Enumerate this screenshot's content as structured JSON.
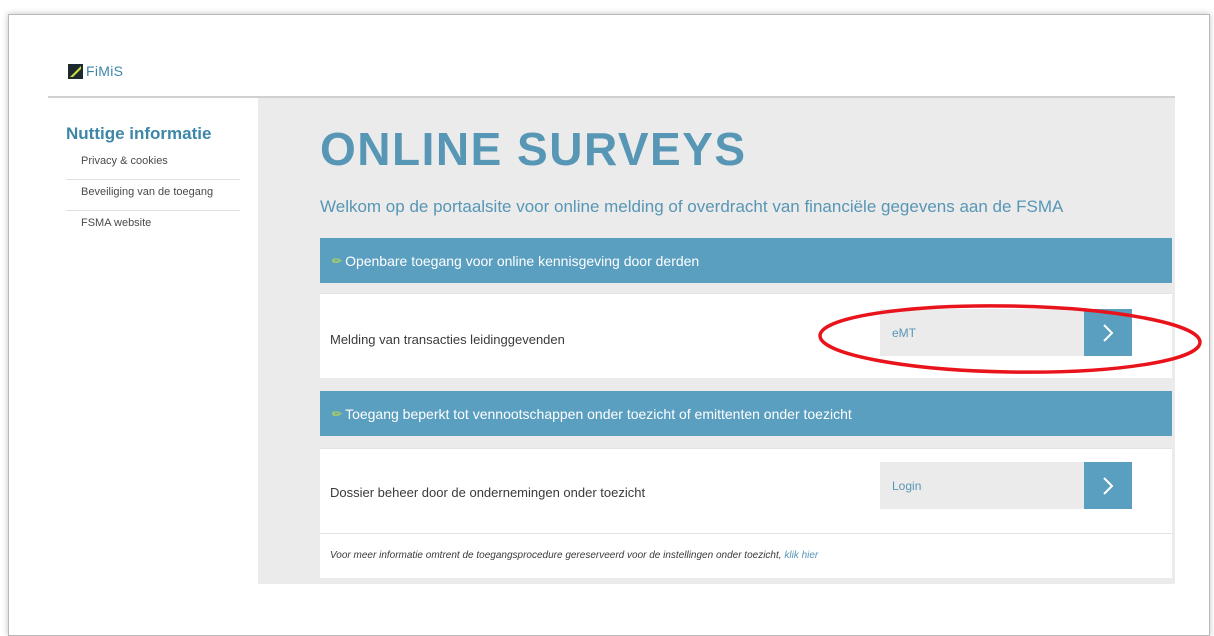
{
  "brand": {
    "name": "FiMiS"
  },
  "sidebar": {
    "title": "Nuttige informatie",
    "items": [
      {
        "label": "Privacy & cookies"
      },
      {
        "label": "Beveiliging van de toegang"
      },
      {
        "label": "FSMA website"
      }
    ]
  },
  "main": {
    "title": "ONLINE SURVEYS",
    "subtitle": "Welkom op de portaalsite voor online melding of overdracht van financiële gegevens aan de FSMA",
    "sections": [
      {
        "header": "Openbare toegang voor online kennisgeving door derden",
        "row_label": "Melding van transacties leidinggevenden",
        "button_text": "eMT"
      },
      {
        "header": "Toegang beperkt tot vennootschappen onder toezicht of emittenten onder toezicht",
        "row_label": "Dossier beheer door de ondernemingen onder toezicht",
        "button_text": "Login"
      }
    ],
    "footer_note": "Voor meer informatie omtrent de toegangsprocedure gereserveerd voor de instellingen onder toezicht, ",
    "footer_link": "klik hier"
  },
  "colors": {
    "accent": "#5a9ec0",
    "title": "#5796b5",
    "pencil": "#c8e040",
    "highlight": "#e8131b"
  },
  "icons": {
    "logo": "fimis-logo-icon",
    "pencil": "pencil-icon",
    "arrow": "chevron-right-icon"
  }
}
